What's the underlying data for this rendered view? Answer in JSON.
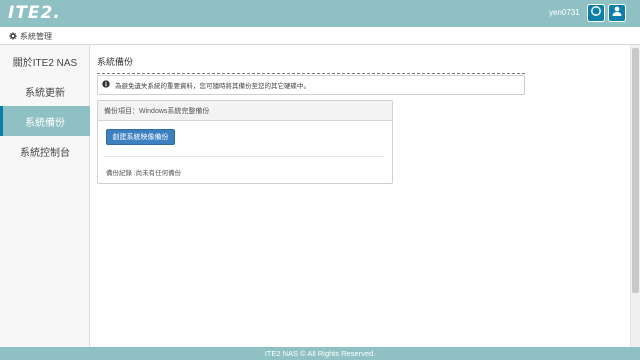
{
  "header": {
    "logo_text": "ITE2.",
    "username": "yen0731",
    "accent_color": "#8fc1c4",
    "icon_button_color": "#0b7faa",
    "refresh_icon": "refresh-icon",
    "user_icon": "user-icon"
  },
  "breadcrumb": {
    "icon": "gear-icon",
    "label": "系統管理"
  },
  "sidebar": {
    "items": [
      {
        "label": "關於ITE2 NAS",
        "active": false
      },
      {
        "label": "系統更新",
        "active": false
      },
      {
        "label": "系統備份",
        "active": true
      },
      {
        "label": "系統控制台",
        "active": false
      }
    ]
  },
  "main": {
    "title": "系統備份",
    "notice": {
      "icon": "info-icon",
      "text": "為避免遺失系統的重要資料，您可隨時將其備份至您的其它硬碟中。"
    },
    "panel": {
      "header": "備份項目：Windows系統完整備份",
      "button_label": "創建系統映像備份",
      "record_text": "備份紀錄 :尚未有任何備份"
    }
  },
  "footer": {
    "text": "ITE2 NAS © All Rights Reserved."
  }
}
